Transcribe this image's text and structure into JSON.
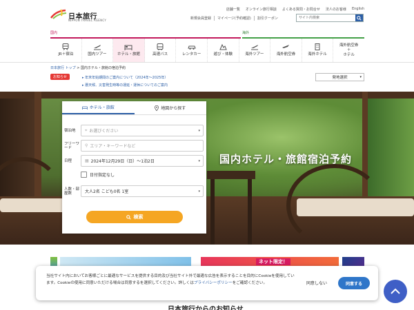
{
  "header": {
    "logo_text": "日本旅行",
    "logo_sub": "NIPPON TRAVEL AGENCY",
    "utility_links": [
      "店舗一覧",
      "オンライン旅行相談",
      "よくある質問・お問合せ",
      "法人のお客様",
      "English"
    ],
    "sub_links": [
      "新規会員登録",
      "マイページ(予約確認)",
      "割引クーポン"
    ],
    "search_placeholder": "サイト内検索"
  },
  "nav": {
    "domestic_label": "国内",
    "overseas_label": "海外",
    "items": [
      {
        "label": "JR＋宿泊",
        "icon": "train-icon"
      },
      {
        "label": "国内ツアー",
        "icon": "plane-icon"
      },
      {
        "label": "ホテル・旅館",
        "icon": "hotel-icon"
      },
      {
        "label": "高速バス",
        "icon": "bus-icon"
      },
      {
        "label": "レンタカー",
        "icon": "car-icon"
      },
      {
        "label": "遊び・体験",
        "icon": "activity-icon"
      },
      {
        "label": "海外ツアー",
        "icon": "plane-icon"
      },
      {
        "label": "海外航空券",
        "icon": "plane-icon"
      },
      {
        "label": "海外ホテル",
        "icon": "hotel-icon"
      },
      {
        "label": "海外航空券\n＋\nホテル",
        "icon": "plane-hotel-icon"
      }
    ]
  },
  "breadcrumb": {
    "home": "日本旅行 トップ",
    "current": "国内ホテル・旅館の宿泊予約"
  },
  "notice": {
    "badge": "お知らせ",
    "items": [
      "年末年始期間のご案内について（2024年〜2025年）",
      "悪天候、災害発生時等の運延・運休についてのご案内"
    ]
  },
  "departure_select": "発地選択",
  "hero": {
    "title": "国内ホテル・旅館宿泊予約"
  },
  "search_panel": {
    "tab_hotel": "ホテル・旅館",
    "tab_map": "地図から探す",
    "dest_label": "宿泊地",
    "dest_placeholder": "お選びください",
    "free_label": "フリーワード",
    "free_placeholder": "エリア・キーワードなど",
    "date_label": "日程",
    "date_value": "2024年12月29日（日）〜1泊2日",
    "no_date_label": "日付指定なし",
    "people_label": "人数・部屋数",
    "people_value": "大人2名 こども0名 1室",
    "search_button": "検索"
  },
  "banners": {
    "net_tag": "ネット限定！"
  },
  "cookie": {
    "text": "当社サイト内においてお客様ごとに最適なサービスを提供する目的及び当社サイト外で最適な広告を表示することを目的にCookieを使用しています。Cookieの使用に同意いただける場合は同意するを選択してください。詳しくは",
    "link": "プライバシーポリシー",
    "tail": "をご確認ください。",
    "deny": "同意しない",
    "agree": "同意する"
  },
  "news_title": "日本旅行からのお知らせ",
  "colors": {
    "domestic": "#c2185b",
    "overseas": "#43a047",
    "brand_blue": "#2b5ea6",
    "search_orange": "#f5a623",
    "cookie_blue": "#2f76c9"
  }
}
